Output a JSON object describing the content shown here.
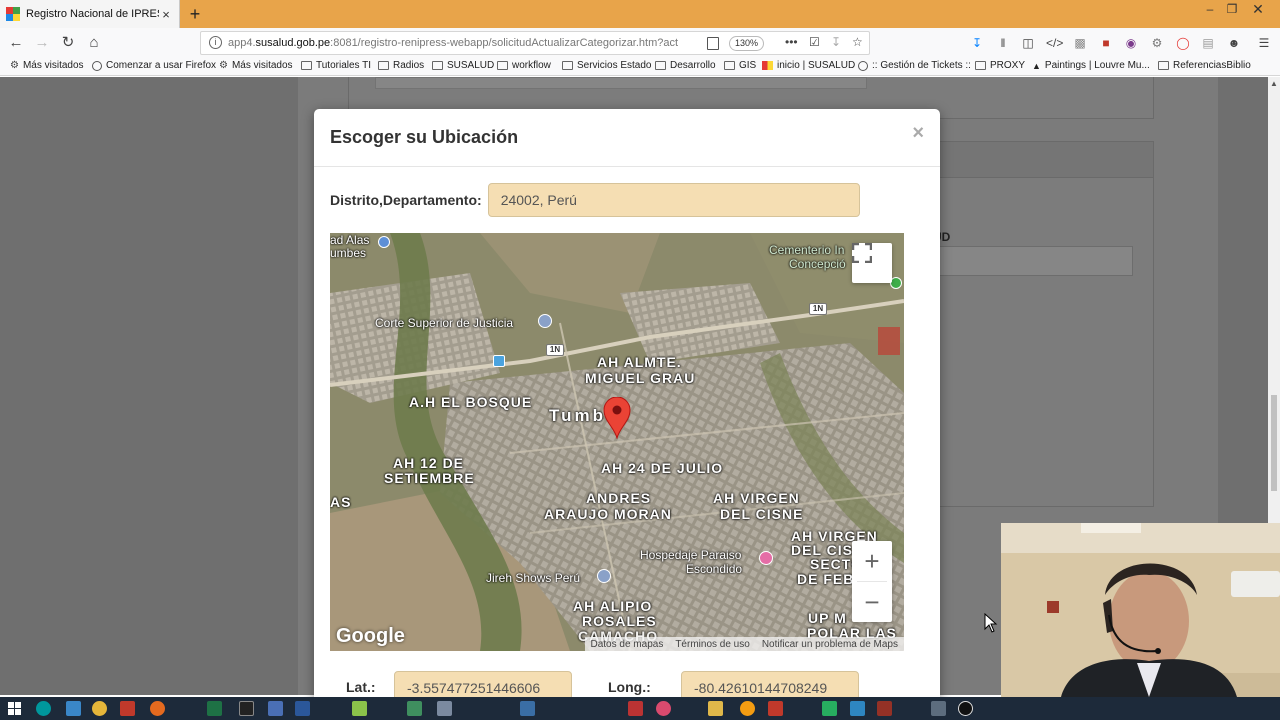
{
  "browser": {
    "tab_title": "Registro Nacional de IPRES",
    "tab_close": "×",
    "new_tab": "+",
    "url_prefix": "app4.",
    "url_domain": "susalud.gob.pe",
    "url_rest": ":8081/registro-renipress-webapp/solicitudActualizarCategorizar.htm?act",
    "zoom": "130%"
  },
  "bookmarks": [
    {
      "label": "Más visitados",
      "icon": "gear-icon"
    },
    {
      "label": "Comenzar a usar Firefox",
      "icon": "globe-icon"
    },
    {
      "label": "Más visitados",
      "icon": "gear-icon"
    },
    {
      "label": "Tutoriales TI",
      "icon": "folder-icon"
    },
    {
      "label": "Radios",
      "icon": "folder-icon"
    },
    {
      "label": "SUSALUD",
      "icon": "folder-icon"
    },
    {
      "label": "workflow",
      "icon": "folder-icon"
    },
    {
      "label": "Servicios Estado",
      "icon": "folder-icon"
    },
    {
      "label": "Desarrollo",
      "icon": "folder-icon"
    },
    {
      "label": "GIS",
      "icon": "folder-icon"
    },
    {
      "label": "inicio | SUSALUD",
      "icon": "susalud-icon"
    },
    {
      "label": ":: Gestión de Tickets ::",
      "icon": "globe-icon"
    },
    {
      "label": "PROXY",
      "icon": "folder-icon"
    },
    {
      "label": "Paintings | Louvre Mu...",
      "icon": "louvre-icon"
    },
    {
      "label": "ReferenciasBiblio",
      "icon": "folder-icon"
    }
  ],
  "background_page": {
    "label_partial": "UD"
  },
  "modal": {
    "title": "Escoger su Ubicación",
    "close": "×",
    "district_label": "Distrito,Departamento:",
    "district_value": "24002, Perú",
    "lat_label": "Lat.:",
    "lat_value": "-3.557477251446606",
    "long_label": "Long.:",
    "long_value": "-80.42610144708249"
  },
  "map": {
    "labels": {
      "alas1": "ad Alas",
      "alas2": "umbes",
      "cementerio1": "Cementerio In",
      "cementerio2": "Concepció",
      "corte": "Corte Superior de Justicia",
      "almte1": "AH ALMTE.",
      "almte2": "MIGUEL GRAU",
      "bosque": "A.H EL BOSQUE",
      "tumbes": "Tumbes",
      "set1": "AH 12 DE",
      "set2": "SETIEMBRE",
      "as": "AS",
      "julio": "AH 24 DE JULIO",
      "andres1": "ANDRES",
      "andres2": "ARAUJO MORAN",
      "virgen1": "AH VIRGEN",
      "virgen2": "DEL CISNE",
      "virgen3a": "AH VIRGEN",
      "virgen3b": "DEL CIS",
      "sector1": "SECTO",
      "sector2": "DE FEBR",
      "hospedaje1": "Hospedaje Paraiso",
      "hospedaje2": "Escondido",
      "jireh": "Jireh Shows Perú",
      "alipio1": "AH ALIPIO",
      "alipio2": "ROSALES",
      "alipio3": "CAMACHO",
      "upm1": "UP M",
      "upm2": "POLAR LAS",
      "route1": "1N",
      "route2": "1N"
    },
    "zoom_in": "+",
    "zoom_out": "−",
    "google": "Google",
    "attrib_data": "Datos de mapas",
    "attrib_terms": "Términos de uso",
    "attrib_report": "Notificar un problema de Maps"
  },
  "colors": {
    "tab_strip": "#e8a44a",
    "input_bg": "#f5deb3",
    "taskbar": "#1d2a3a",
    "pin": "#ea4335"
  }
}
